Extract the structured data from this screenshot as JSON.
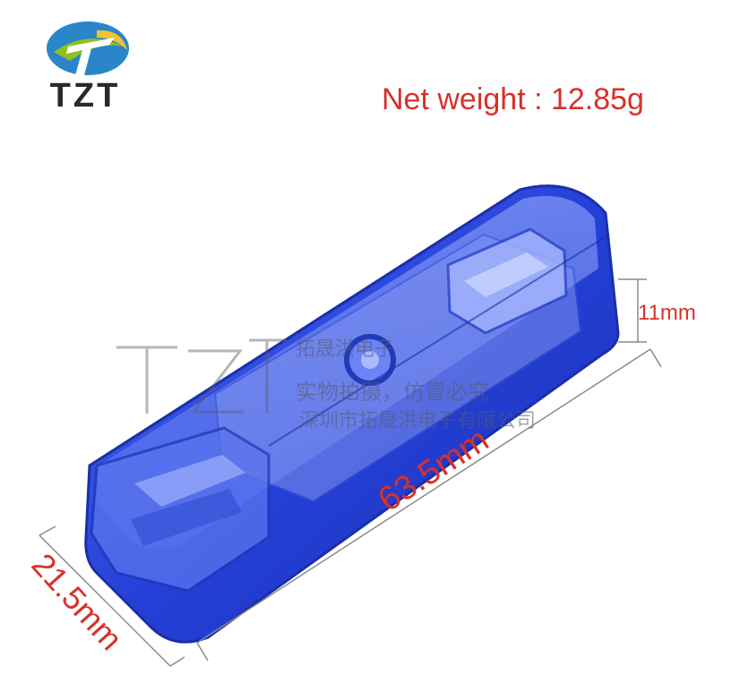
{
  "brand": {
    "logo_text": "TZT",
    "logo_colors": {
      "blue": "#2a86c9",
      "green": "#8fc21f",
      "yellow": "#f1c232"
    }
  },
  "product": {
    "weight_label": "Net weight : 12.85g",
    "case_color": "#2540d8"
  },
  "dimensions": {
    "height": "11mm",
    "length": "63.5mm",
    "width": "21.5mm"
  },
  "watermark": {
    "line1": "拓晟洪电子",
    "line2": "实物拍摄，仿冒必究",
    "line3": "深圳市拓晟洪电子有限公司"
  },
  "colors": {
    "label_red": "#d7312a",
    "background": "#ffffff"
  }
}
